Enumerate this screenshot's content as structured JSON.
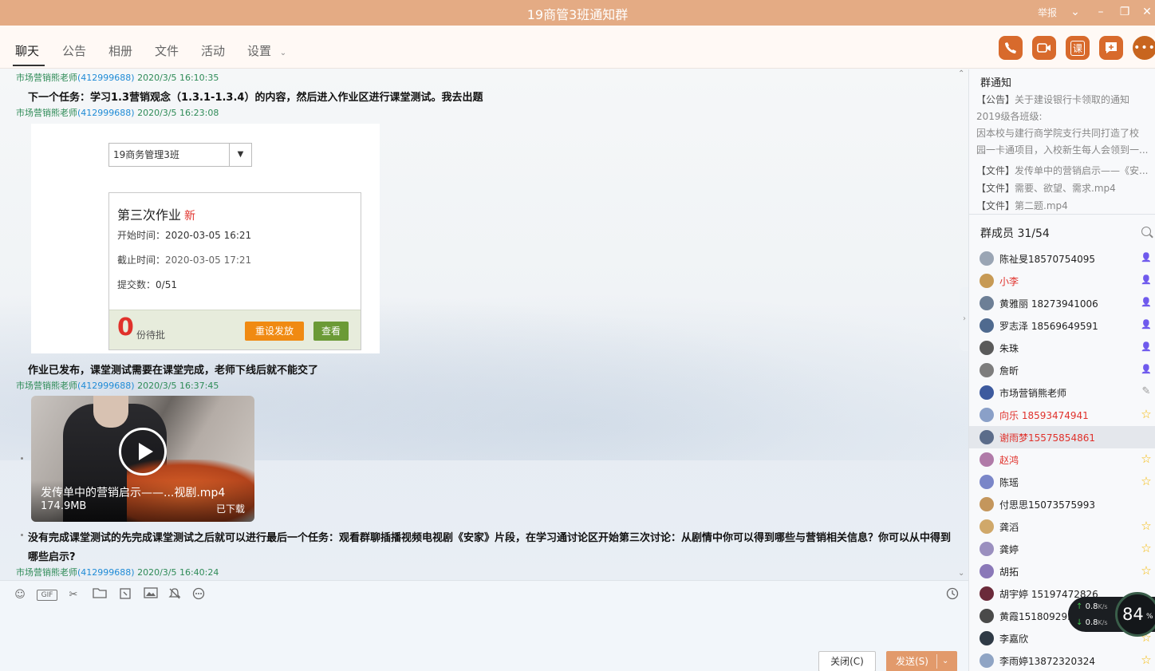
{
  "window": {
    "title": "19商管3班通知群",
    "report_label": "举报"
  },
  "nav": {
    "tabs": [
      "聊天",
      "公告",
      "相册",
      "文件",
      "活动",
      "设置"
    ],
    "actions": [
      "phone-icon",
      "video-call-icon",
      "class-icon",
      "add-chat-icon",
      "more-icon"
    ],
    "class_label": "课"
  },
  "messages": [
    {
      "sender": "市场营销熊老师",
      "qq": "(412999688)",
      "time": "2020/3/5 16:10:35",
      "text": "下一个任务：学习1.3营销观念（1.3.1-1.3.4）的内容，然后进入作业区进行课堂测试。我去出题"
    },
    {
      "sender": "市场营销熊老师",
      "qq": "(412999688)",
      "time": "2020/3/5 16:23:08",
      "text": "作业已发布，课堂测试需要在课堂完成，老师下线后就不能交了"
    },
    {
      "sender": "市场营销熊老师",
      "qq": "(412999688)",
      "time": "2020/3/5 16:37:45",
      "text_line1": "没有完成课堂测试的先完成课堂测试之后就可以进行最后一个任务：观看群聊插播视频电视剧《安家》片段，在学习通讨论区开始第三次讨论：从剧情中你可以得到哪些与营销相关信息？你可以从中得到",
      "text_line2": "哪些启示?"
    },
    {
      "sender": "市场营销熊老师",
      "qq": "(412999688)",
      "time": "2020/3/5 16:40:24"
    }
  ],
  "homework": {
    "class_select": "19商务管理3班",
    "title": "第三次作业",
    "new_tag": "新",
    "start_label": "开始时间：",
    "start": "2020-03-05 16:21",
    "end_label": "截止时间：",
    "end": "2020-03-05 17:21",
    "submit_label": "提交数：",
    "submit": "0/51",
    "pending_count": "0",
    "pending_label": "份待批",
    "reset_button": "重设发放",
    "view_button": "查看"
  },
  "video": {
    "name": "发传单中的营销启示——...视剧.mp4",
    "size": "174.9MB",
    "status": "已下载"
  },
  "input": {
    "close_button": "关闭(C)",
    "send_button": "发送(S)",
    "gif_label": "GIF"
  },
  "notice": {
    "title": "群通知",
    "lines": [
      {
        "tag": "【公告】",
        "text": "关于建设银行卡领取的通知"
      },
      {
        "tag": "",
        "text": "2019级各班级:"
      },
      {
        "tag": "",
        "text": " 因本校与建行商学院支行共同打造了校"
      },
      {
        "tag": "",
        "text": "园一卡通项目，入校新生每人会领到一..."
      },
      {
        "tag": "【文件】",
        "text": "发传单中的营销启示——《安..."
      },
      {
        "tag": "【文件】",
        "text": "需要、欲望、需求.mp4"
      },
      {
        "tag": "【文件】",
        "text": "第二题.mp4"
      }
    ]
  },
  "members": {
    "title": "群成员 31/54",
    "list": [
      {
        "name": "陈祉旻18570754095",
        "red": false,
        "badge": "person"
      },
      {
        "name": "小李",
        "red": true,
        "badge": "person"
      },
      {
        "name": "黄雅丽 18273941006",
        "red": false,
        "badge": "person"
      },
      {
        "name": "罗志泽 18569649591",
        "red": false,
        "badge": "person-star"
      },
      {
        "name": "朱珠",
        "red": false,
        "badge": "person"
      },
      {
        "name": "詹昕",
        "red": false,
        "badge": "person-star"
      },
      {
        "name": "市场营销熊老师",
        "red": false,
        "badge": "edit"
      },
      {
        "name": "向乐 18593474941",
        "red": true,
        "badge": "star"
      },
      {
        "name": "谢雨梦15575854861",
        "red": true,
        "badge": "none"
      },
      {
        "name": "赵鸿",
        "red": true,
        "badge": "star"
      },
      {
        "name": "陈瑶",
        "red": false,
        "badge": "star"
      },
      {
        "name": "付思思15073575993",
        "red": false,
        "badge": "none"
      },
      {
        "name": "龚滔",
        "red": false,
        "badge": "star"
      },
      {
        "name": "龚婷",
        "red": false,
        "badge": "star"
      },
      {
        "name": "胡拓",
        "red": false,
        "badge": "star"
      },
      {
        "name": "胡宇婷 15197472826",
        "red": false,
        "badge": "none"
      },
      {
        "name": "黄霞151809293",
        "red": false,
        "badge": "none"
      },
      {
        "name": "李嘉欣",
        "red": false,
        "badge": "star"
      },
      {
        "name": "李雨婷13872320324",
        "red": false,
        "badge": "star"
      }
    ]
  },
  "net_widget": {
    "up": "0.8",
    "down": "0.8",
    "unit": "K/s",
    "percent": "84",
    "percent_sign": "%"
  }
}
